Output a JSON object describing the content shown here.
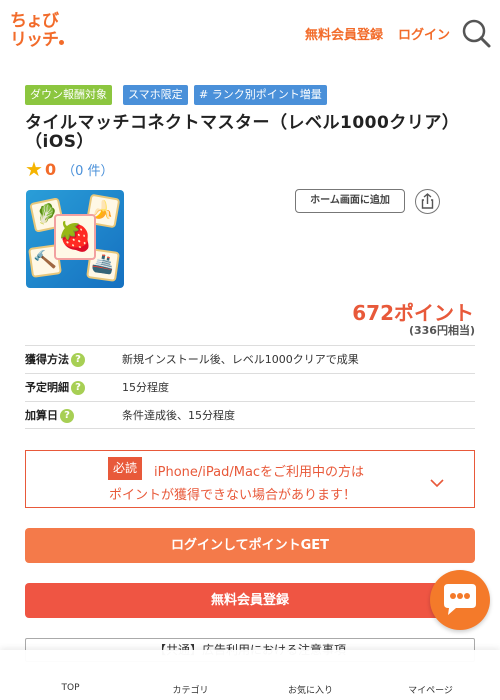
{
  "header": {
    "logo_line1": "ちょび",
    "logo_line2": "リッチ",
    "register_link": "無料会員登録",
    "login_link": "ログイン",
    "search_icon": "search-icon"
  },
  "badges": [
    "ダウン報酬対象",
    "スマホ限定",
    "# ランク別ポイント増量"
  ],
  "offer": {
    "title": "タイルマッチコネクトマスター（レベル1000クリア）（iOS）",
    "rating": "0",
    "rating_count_open": "（",
    "rating_count": "0 件",
    "rating_count_close": "）",
    "home_button": "ホーム画面に追加",
    "points": "672ポイント",
    "yen": "(336円相当)"
  },
  "info_rows": [
    {
      "label": "獲得方法",
      "value": "新規インストール後、レベル1000クリアで成果"
    },
    {
      "label": "予定明細",
      "value": "15分程度"
    },
    {
      "label": "加算日",
      "value": "条件達成後、15分程度"
    }
  ],
  "notice": {
    "badge": "必読",
    "line1": "iPhone/iPad/Macをご利用中の方は",
    "line2": "ポイントが獲得できない場合があります！"
  },
  "buttons": {
    "login_get": "ログインしてポイントGET",
    "register": "無料会員登録"
  },
  "caution_text": "【共通】広告利用における注意事項",
  "bottom_nav": [
    {
      "label": "TOP",
      "icon": "home-icon"
    },
    {
      "label": "カテゴリ",
      "icon": "category-icon"
    },
    {
      "label": "お気に入り",
      "icon": "heart-icon"
    },
    {
      "label": "マイページ",
      "icon": "user-icon"
    }
  ],
  "colors": {
    "brand": "#f26b2a",
    "points": "#e8593a",
    "badge_green": "#8cc63f",
    "badge_blue": "#4a90d9"
  }
}
